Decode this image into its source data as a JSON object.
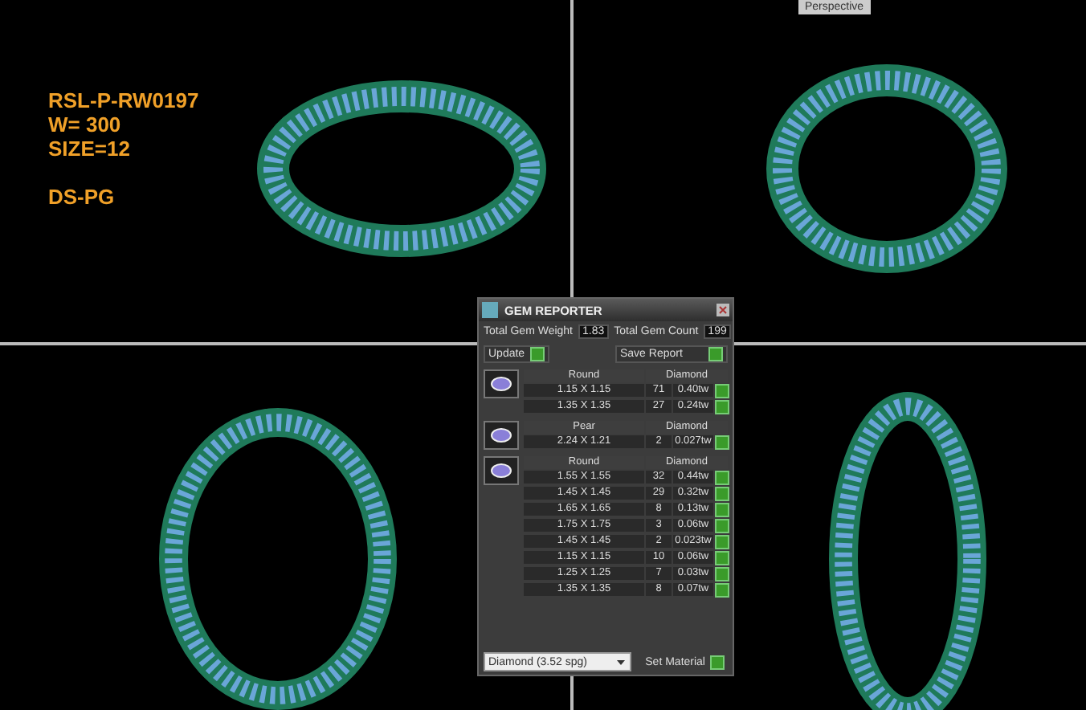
{
  "model_label": {
    "lines": [
      "RSL-P-RW0197",
      "W= 300",
      "SIZE=12"
    ],
    "code": "DS-PG"
  },
  "perspective_tab": "Perspective",
  "gem_reporter": {
    "title": "GEM REPORTER",
    "total_weight_label": "Total Gem Weight",
    "total_weight": "1.83",
    "total_count_label": "Total Gem Count",
    "total_count": "199",
    "update_button": "Update",
    "save_button": "Save Report",
    "groups": [
      {
        "shape": "Round",
        "material": "Diamond",
        "rows": [
          {
            "size": "1.15 X 1.15",
            "count": "71",
            "weight": "0.40tw"
          },
          {
            "size": "1.35 X 1.35",
            "count": "27",
            "weight": "0.24tw"
          }
        ]
      },
      {
        "shape": "Pear",
        "material": "Diamond",
        "rows": [
          {
            "size": "2.24 X 1.21",
            "count": "2",
            "weight": "0.027tw"
          }
        ]
      },
      {
        "shape": "Round",
        "material": "Diamond",
        "rows": [
          {
            "size": "1.55 X 1.55",
            "count": "32",
            "weight": "0.44tw"
          },
          {
            "size": "1.45 X 1.45",
            "count": "29",
            "weight": "0.32tw"
          },
          {
            "size": "1.65 X 1.65",
            "count": "8",
            "weight": "0.13tw"
          },
          {
            "size": "1.75 X 1.75",
            "count": "3",
            "weight": "0.06tw"
          },
          {
            "size": "1.45 X 1.45",
            "count": "2",
            "weight": "0.023tw"
          },
          {
            "size": "1.15 X 1.15",
            "count": "10",
            "weight": "0.06tw"
          },
          {
            "size": "1.25 X 1.25",
            "count": "7",
            "weight": "0.03tw"
          },
          {
            "size": "1.35 X 1.35",
            "count": "8",
            "weight": "0.07tw"
          }
        ]
      }
    ],
    "material_select": "Diamond   (3.52 spg)",
    "set_material_button": "Set Material"
  }
}
